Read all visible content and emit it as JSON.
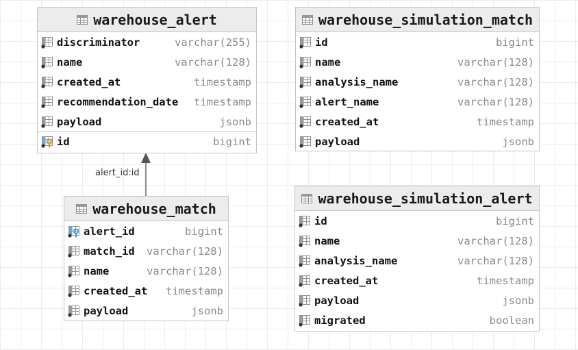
{
  "tables": [
    {
      "name": "warehouse_alert",
      "columns": [
        {
          "name": "discriminator",
          "type": "varchar(255)",
          "icon": "column-icon"
        },
        {
          "name": "name",
          "type": "varchar(128)",
          "icon": "column-icon"
        },
        {
          "name": "created_at",
          "type": "timestamp",
          "icon": "column-icon"
        },
        {
          "name": "recommendation_date",
          "type": "timestamp",
          "icon": "column-icon"
        },
        {
          "name": "payload",
          "type": "jsonb",
          "icon": "column-icon"
        }
      ],
      "key_columns": [
        {
          "name": "id",
          "type": "bigint",
          "icon": "primary-key-icon"
        }
      ]
    },
    {
      "name": "warehouse_simulation_match",
      "columns": [
        {
          "name": "id",
          "type": "bigint",
          "icon": "column-icon"
        },
        {
          "name": "name",
          "type": "varchar(128)",
          "icon": "column-icon"
        },
        {
          "name": "analysis_name",
          "type": "varchar(128)",
          "icon": "column-icon"
        },
        {
          "name": "alert_name",
          "type": "varchar(128)",
          "icon": "column-icon"
        },
        {
          "name": "created_at",
          "type": "timestamp",
          "icon": "column-icon"
        },
        {
          "name": "payload",
          "type": "jsonb",
          "icon": "column-icon"
        }
      ]
    },
    {
      "name": "warehouse_match",
      "columns": [
        {
          "name": "alert_id",
          "type": "bigint",
          "icon": "foreign-key-icon"
        },
        {
          "name": "match_id",
          "type": "varchar(128)",
          "icon": "column-icon"
        },
        {
          "name": "name",
          "type": "varchar(128)",
          "icon": "column-icon"
        },
        {
          "name": "created_at",
          "type": "timestamp",
          "icon": "column-icon"
        },
        {
          "name": "payload",
          "type": "jsonb",
          "icon": "column-icon"
        }
      ]
    },
    {
      "name": "warehouse_simulation_alert",
      "columns": [
        {
          "name": "id",
          "type": "bigint",
          "icon": "column-icon"
        },
        {
          "name": "name",
          "type": "varchar(128)",
          "icon": "column-icon"
        },
        {
          "name": "analysis_name",
          "type": "varchar(128)",
          "icon": "column-icon"
        },
        {
          "name": "created_at",
          "type": "timestamp",
          "icon": "column-icon"
        },
        {
          "name": "payload",
          "type": "jsonb",
          "icon": "column-icon"
        },
        {
          "name": "migrated",
          "type": "boolean",
          "icon": "column-icon"
        }
      ]
    }
  ],
  "relations": [
    {
      "from": "warehouse_match",
      "to": "warehouse_alert",
      "label": "alert_id:id"
    }
  ],
  "colors": {
    "header_bg": "#ececec",
    "border": "#c4c4c4",
    "type_text": "#8a8a8a",
    "key_icon": "#d4a017",
    "fk_icon": "#3fa7d6"
  }
}
